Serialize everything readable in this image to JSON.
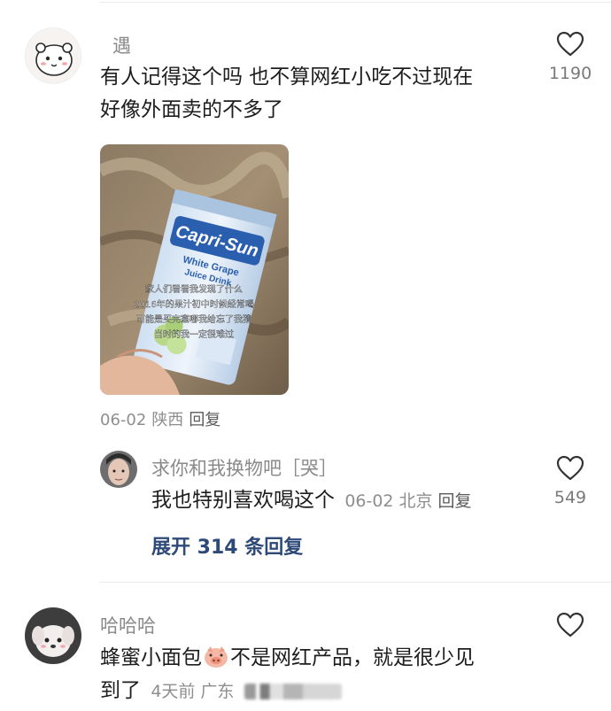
{
  "comments": [
    {
      "username": "遇",
      "text_line1": "有人记得这个吗 也不算网红小吃不过现在",
      "text_line2": "好像外面卖的不多了",
      "date": "06-02",
      "location": "陕西",
      "reply_label": "回复",
      "likes": "1190",
      "image": {
        "brand": "Capri-Sun",
        "flavor_line1": "White Grape",
        "flavor_line2": "Juice Drink",
        "caption_line1": "家人们看看我发现了什么",
        "caption_line2": "2016年的果汁初中时候经常喝",
        "caption_line3": "可能是买完塞哪我给忘了我猜",
        "caption_line4": "当时的我一定很难过"
      }
    },
    {
      "username": "求你和我换物吧［哭］",
      "text": "我也特别喜欢喝这个",
      "date": "06-02",
      "location": "北京",
      "reply_label": "回复",
      "likes": "549"
    },
    {
      "username": "哈哈哈",
      "text_line1_a": "蜂蜜小面包",
      "text_line1_b": "不是网红产品，就是很少见",
      "text_line2": "到了",
      "date": "4天前",
      "location": "广东",
      "emoji": "pig-face-emoji"
    }
  ],
  "expand_replies": "展开 314 条回复",
  "icons": {
    "like": "heart-outline-icon"
  },
  "colors": {
    "expand_link": "#2d4a78",
    "meta_text": "#8e8e8e",
    "username": "#8a8a8a"
  }
}
